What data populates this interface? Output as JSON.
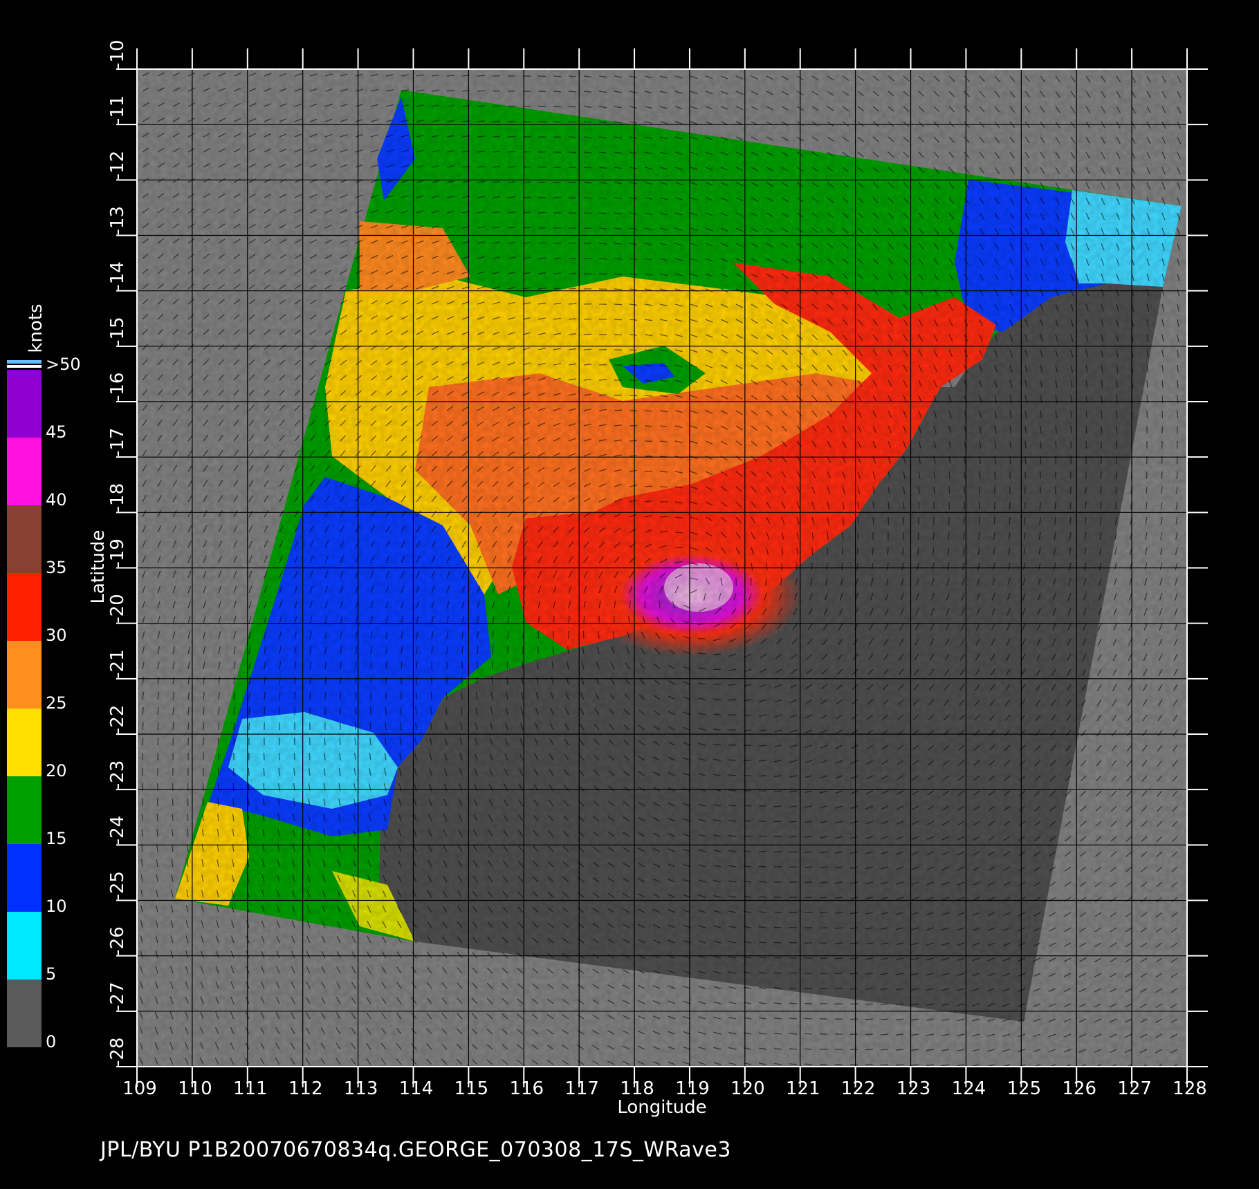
{
  "map": {
    "title": "",
    "xlabel": "Longitude",
    "ylabel": "Latitude",
    "lon_range": [
      109,
      128
    ],
    "lat_range": [
      -28,
      -10
    ],
    "lon_ticks": [
      "109",
      "110",
      "111",
      "112",
      "113",
      "114",
      "115",
      "116",
      "117",
      "118",
      "119",
      "120",
      "121",
      "122",
      "123",
      "124",
      "125",
      "126",
      "127",
      "128"
    ],
    "lat_ticks": [
      "-10",
      "-11",
      "-12",
      "-13",
      "-14",
      "-15",
      "-16",
      "-17",
      "-18",
      "-19",
      "-20",
      "-21",
      "-22",
      "-23",
      "-24",
      "-25",
      "-26",
      "-27",
      "-28"
    ],
    "grid": true
  },
  "colorbar": {
    "unit_label": "knots",
    "tick_labels": [
      "0",
      "5",
      "10",
      "15",
      "20",
      "25",
      "30",
      "35",
      "40",
      "45",
      ">50"
    ],
    "colors": [
      "#5a5a5a",
      "#00e8ff",
      "#0030ff",
      "#00a000",
      "#ffe000",
      "#ff9020",
      "#ff2000",
      "#8a4030",
      "#ff10e0",
      "#9000d0",
      "#8030ff"
    ]
  },
  "legend_colors": {
    "land": "#4f4f4f",
    "no_data": "#828282",
    "background": "#000000"
  },
  "footer": {
    "caption": "JPL/BYU  P1B20070670834q.GEORGE_070308_17S_WRave3"
  }
}
